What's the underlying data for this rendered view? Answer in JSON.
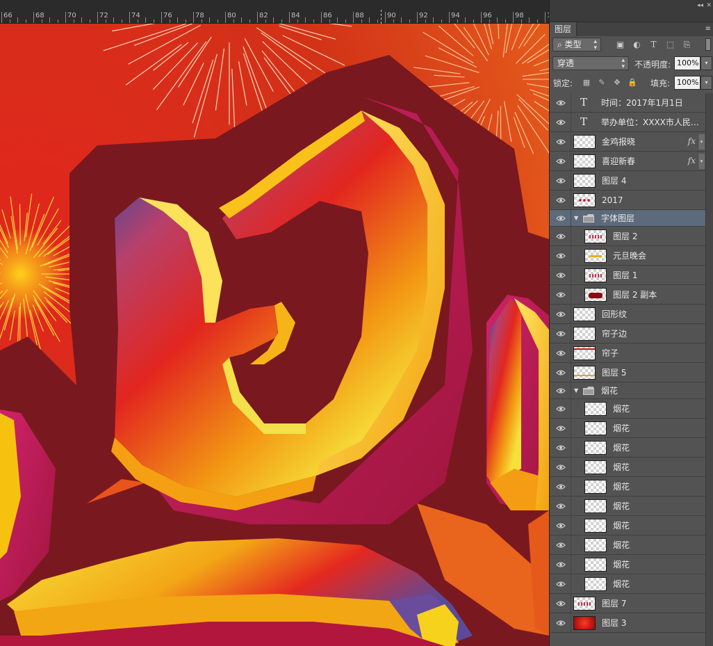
{
  "ruler": {
    "labels": [
      "66",
      "68",
      "70",
      "72",
      "74",
      "76",
      "78",
      "80",
      "82",
      "84",
      "86",
      "88",
      "90",
      "92",
      "94",
      "96",
      "98",
      "1"
    ]
  },
  "panel": {
    "collapse_glyph": "◂◂",
    "close_glyph": "✕",
    "tab_label": "图层",
    "menu_glyph": "≡",
    "filter": {
      "kind_label": "类型",
      "icons": [
        "image-filter-icon",
        "adjustment-filter-icon",
        "type-filter-icon",
        "shape-filter-icon",
        "smart-object-filter-icon"
      ]
    },
    "blend_mode": "穿透",
    "opacity_label": "不透明度:",
    "opacity_value": "100%",
    "lock_label": "锁定:",
    "fill_label": "填充:",
    "fill_value": "100%"
  },
  "layers": [
    {
      "name": "时间：2017年1月1日",
      "kind": "text"
    },
    {
      "name": "举办单位：XXXX市人民…",
      "kind": "text"
    },
    {
      "name": "金鸡报晓",
      "kind": "pixel",
      "fx": true
    },
    {
      "name": "喜迎新春",
      "kind": "pixel",
      "fx": true
    },
    {
      "name": "图层 4",
      "kind": "pixel"
    },
    {
      "name": "2017",
      "kind": "pixel"
    },
    {
      "name": "字体图层",
      "kind": "group",
      "selected": true
    },
    {
      "name": "图层 2",
      "kind": "pixel",
      "indent": true
    },
    {
      "name": "元旦晚会",
      "kind": "pixel",
      "indent": true
    },
    {
      "name": "图层 1",
      "kind": "pixel",
      "indent": true
    },
    {
      "name": "图层 2 副本",
      "kind": "pixel",
      "indent": true
    },
    {
      "name": "回形纹",
      "kind": "pixel"
    },
    {
      "name": "帘子边",
      "kind": "pixel"
    },
    {
      "name": "帘子",
      "kind": "pixel"
    },
    {
      "name": "图层 5",
      "kind": "pixel"
    },
    {
      "name": "烟花",
      "kind": "group"
    },
    {
      "name": "烟花",
      "kind": "pixel",
      "indent": true
    },
    {
      "name": "烟花",
      "kind": "pixel",
      "indent": true
    },
    {
      "name": "烟花",
      "kind": "pixel",
      "indent": true
    },
    {
      "name": "烟花",
      "kind": "pixel",
      "indent": true
    },
    {
      "name": "烟花",
      "kind": "pixel",
      "indent": true
    },
    {
      "name": "烟花",
      "kind": "pixel",
      "indent": true
    },
    {
      "name": "烟花",
      "kind": "pixel",
      "indent": true
    },
    {
      "name": "烟花",
      "kind": "pixel",
      "indent": true
    },
    {
      "name": "烟花",
      "kind": "pixel",
      "indent": true
    },
    {
      "name": "烟花",
      "kind": "pixel",
      "indent": true
    },
    {
      "name": "图层 7",
      "kind": "pixel"
    },
    {
      "name": "图层 3",
      "kind": "pixel"
    }
  ]
}
